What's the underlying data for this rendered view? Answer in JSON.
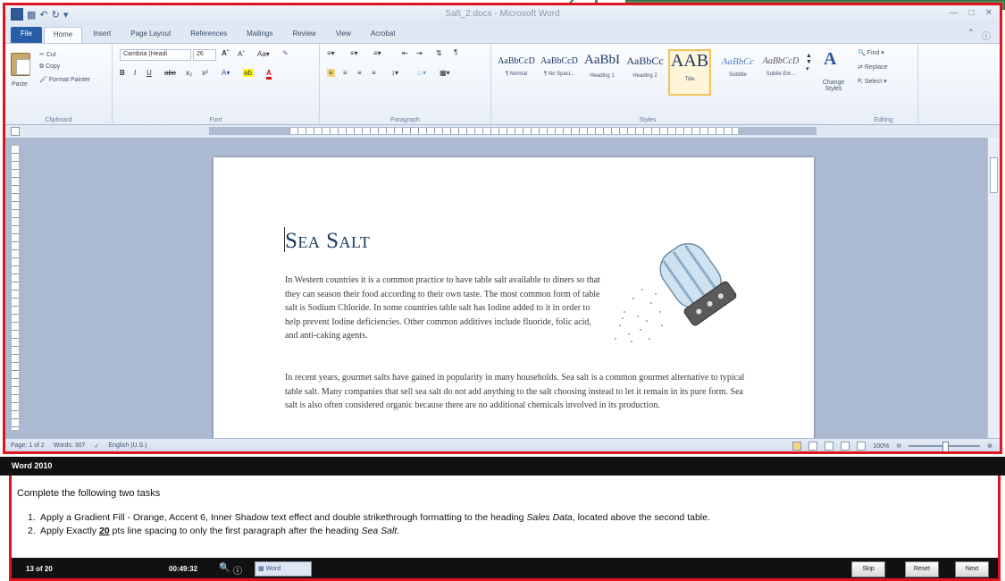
{
  "window": {
    "title": "Salt_2.docx - Microsoft Word"
  },
  "tabs": [
    "File",
    "Home",
    "Insert",
    "Page Layout",
    "References",
    "Mailings",
    "Review",
    "View",
    "Acrobat"
  ],
  "ribbon": {
    "clipboard": {
      "paste": "Paste",
      "cut": "Cut",
      "copy": "Copy",
      "format_painter": "Format Painter",
      "label": "Clipboard"
    },
    "font": {
      "font_name": "Cambria (Headi",
      "font_size": "26",
      "label": "Font"
    },
    "paragraph": {
      "label": "Paragraph"
    },
    "styles": {
      "label": "Styles",
      "items": [
        {
          "sample": "AaBbCcD",
          "name": "¶ Normal"
        },
        {
          "sample": "AaBbCcD",
          "name": "¶ No Spaci..."
        },
        {
          "sample": "AaBbI",
          "name": "Heading 1"
        },
        {
          "sample": "AaBbCc",
          "name": "Heading 2"
        },
        {
          "sample": "AAB",
          "name": "Title"
        },
        {
          "sample": "AaBbCc",
          "name": "Subtitle"
        },
        {
          "sample": "AaBbCcD",
          "name": "Subtle Em..."
        }
      ],
      "change_styles": "Change Styles"
    },
    "editing": {
      "find": "Find",
      "replace": "Replace",
      "select": "Select",
      "label": "Editing"
    }
  },
  "document": {
    "heading": "Sea Salt",
    "paragraph1": "In Western countries it is a common practice to have table salt available to diners so that they can season their food according to their own taste. The most common form of table salt is Sodium Chloride. In some countries table salt has Iodine added to it in order to help prevent Iodine deficiencies. Other common additives include fluoride, folic acid, and anti-caking agents.",
    "paragraph2": "In recent years, gourmet salts have gained in popularity in many households. Sea salt is a common gourmet alternative to typical table salt. Many companies that sell sea salt do not add anything to the salt choosing instead to let it remain in its pure form. Sea salt is also often considered organic because there are no additional chemicals involved in its production."
  },
  "statusbar": {
    "page": "Page: 1 of 2",
    "words": "Words: 307",
    "language": "English (U.S.)",
    "zoom": "100%"
  },
  "exam": {
    "header": "Word 2010",
    "intro": "Complete the following two tasks",
    "tasks": [
      {
        "num": "1.",
        "before": "Apply a Gradient Fill - Orange, Accent 6, Inner Shadow text effect and double strikethrough formatting to the heading ",
        "emph": "Sales Data",
        "after": ", located above the second table."
      },
      {
        "num": "2.",
        "before": "Apply Exactly ",
        "bold": "20",
        "middle": " pts line spacing to only the first paragraph after the heading ",
        "emph": "Sea Salt",
        "after": "."
      }
    ],
    "progress": "13 of 20",
    "timer": "00:49:32",
    "taskbar_item": "Word",
    "buttons": {
      "skip": "Skip",
      "reset": "Reset",
      "next": "Next"
    }
  }
}
